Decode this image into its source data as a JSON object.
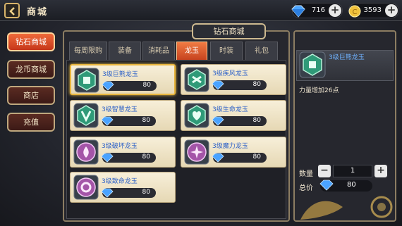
{
  "header": {
    "title": "商城",
    "currencies": [
      {
        "icon": "diamond-icon",
        "value": "716"
      },
      {
        "icon": "gold-coin-icon",
        "value": "3593"
      }
    ]
  },
  "sidebar": {
    "items": [
      {
        "label": "钻石商城",
        "active": true
      },
      {
        "label": "龙币商城",
        "active": false
      },
      {
        "label": "商店",
        "active": false
      },
      {
        "label": "充值",
        "active": false
      }
    ]
  },
  "shop": {
    "title": "钻石商城",
    "tabs": [
      {
        "label": "每周限购",
        "active": false
      },
      {
        "label": "装备",
        "active": false
      },
      {
        "label": "消耗品",
        "active": false
      },
      {
        "label": "龙玉",
        "active": true
      },
      {
        "label": "时装",
        "active": false
      },
      {
        "label": "礼包",
        "active": false
      }
    ],
    "items": [
      {
        "name": "3级巨熊龙玉",
        "price": "80",
        "icon": "bear-dragon-jade-icon",
        "selected": true
      },
      {
        "name": "3级疾风龙玉",
        "price": "80",
        "icon": "wind-dragon-jade-icon",
        "selected": false
      },
      {
        "name": "3级智慧龙玉",
        "price": "80",
        "icon": "wisdom-dragon-jade-icon",
        "selected": false
      },
      {
        "name": "3级生命龙玉",
        "price": "80",
        "icon": "life-dragon-jade-icon",
        "selected": false
      },
      {
        "name": "3级破坏龙玉",
        "price": "80",
        "icon": "destruction-dragon-jade-icon",
        "selected": false
      },
      {
        "name": "3级魔力龙玉",
        "price": "80",
        "icon": "magic-dragon-jade-icon",
        "selected": false
      },
      {
        "name": "3级致命龙玉",
        "price": "80",
        "icon": "lethal-dragon-jade-icon",
        "selected": false
      }
    ]
  },
  "detail": {
    "name": "3级巨熊龙玉",
    "description": "力量增加26点",
    "quantity_label": "数量",
    "quantity": "1",
    "total_label": "总价",
    "total": "80"
  },
  "colors": {
    "accent": "#e8632f",
    "jade_green": "#2f9a78",
    "jade_purple": "#a455a8",
    "item_name": "#2a5fc8"
  }
}
